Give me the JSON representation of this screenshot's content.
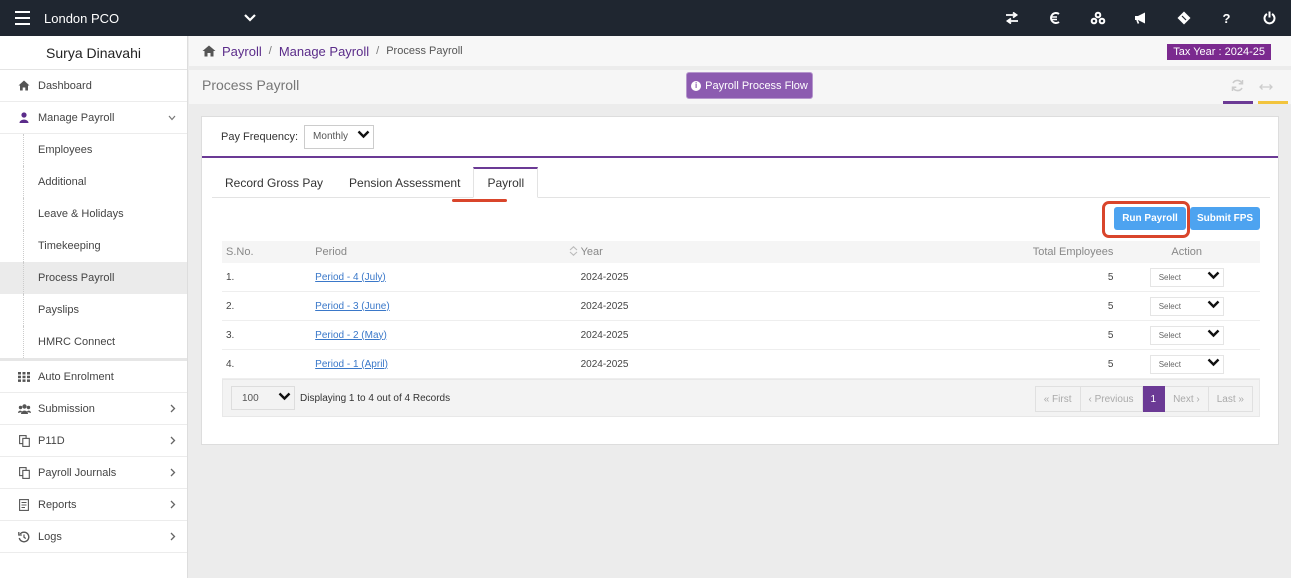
{
  "topbar": {
    "company": "London PCO",
    "icons": [
      "transfer-icon",
      "currency-icon",
      "cubes-icon",
      "bullhorn-icon",
      "ticket-icon",
      "help-icon",
      "power-icon"
    ],
    "help_label": "?"
  },
  "sidebar": {
    "user_name": "Surya Dinavahi",
    "items": [
      {
        "label": "Dashboard",
        "icon": "home-icon"
      },
      {
        "label": "Manage Payroll",
        "icon": "user-icon"
      },
      {
        "label": "Auto Enrolment",
        "icon": "grid-icon"
      },
      {
        "label": "Submission",
        "icon": "users-icon"
      },
      {
        "label": "P11D",
        "icon": "copy-icon"
      },
      {
        "label": "Payroll Journals",
        "icon": "copy-icon"
      },
      {
        "label": "Reports",
        "icon": "report-icon"
      },
      {
        "label": "Logs",
        "icon": "history-icon"
      }
    ],
    "sub_items": [
      {
        "label": "Employees"
      },
      {
        "label": "Additional"
      },
      {
        "label": "Leave & Holidays"
      },
      {
        "label": "Timekeeping"
      },
      {
        "label": "Process Payroll"
      },
      {
        "label": "Payslips"
      },
      {
        "label": "HMRC Connect"
      }
    ]
  },
  "breadcrumb": {
    "home": "Payroll",
    "sep": "/",
    "manage": "Manage Payroll",
    "current": "Process Payroll"
  },
  "tax_year": "Tax Year : 2024-25",
  "page_title": "Process Payroll",
  "flow_button": "Payroll Process Flow",
  "pay_frequency": {
    "label": "Pay Frequency:",
    "value": "Monthly"
  },
  "tabs": [
    {
      "label": "Record Gross Pay"
    },
    {
      "label": "Pension Assessment"
    },
    {
      "label": "Payroll"
    }
  ],
  "buttons": {
    "run_payroll": "Run Payroll",
    "submit_fps": "Submit FPS"
  },
  "table": {
    "headers": {
      "sno": "S.No.",
      "period": "Period",
      "year": "Year",
      "total": "Total Employees",
      "action": "Action"
    },
    "rows": [
      {
        "sno": "1.",
        "period": "Period - 4 (July)",
        "year": "2024-2025",
        "total": "5",
        "action": "Select"
      },
      {
        "sno": "2.",
        "period": "Period - 3 (June)",
        "year": "2024-2025",
        "total": "5",
        "action": "Select"
      },
      {
        "sno": "3.",
        "period": "Period - 2 (May)",
        "year": "2024-2025",
        "total": "5",
        "action": "Select"
      },
      {
        "sno": "4.",
        "period": "Period - 1 (April)",
        "year": "2024-2025",
        "total": "5",
        "action": "Select"
      }
    ]
  },
  "pager": {
    "page_size": "100",
    "display_text": "Displaying 1 to 4 out of 4 Records",
    "first": "« First",
    "previous": "‹ Previous",
    "current": "1",
    "next": "Next ›",
    "last": "Last »"
  },
  "colors": {
    "topbar": "#1f2630",
    "accent": "#6b3a95",
    "button": "#4da3f0",
    "tax_year": "#7b2a8f",
    "highlight": "#d9452b"
  }
}
